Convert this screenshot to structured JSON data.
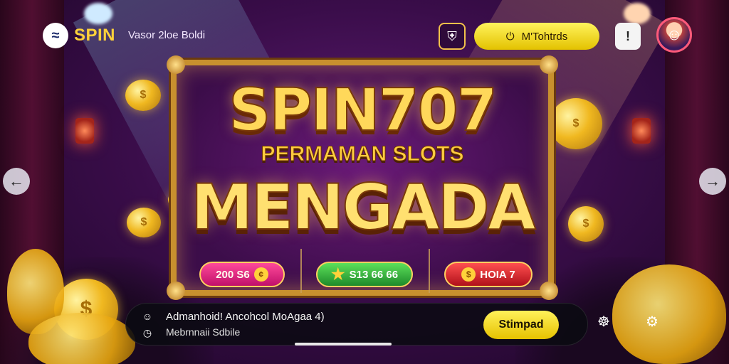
{
  "header": {
    "logo_mark": "≈",
    "logo_text": "SPIN",
    "tagline": "Vasor 2loe Boldi",
    "shield_icon": "shield-check-icon",
    "shield_glyph": "⛨",
    "cta_icon": "power-icon",
    "cta_glyph": "⏻",
    "cta_label": "M'Tohtrds",
    "alert_icon": "alert-icon",
    "alert_glyph": "!",
    "avatar_glyph": "☺"
  },
  "banner": {
    "title": "SPIN707",
    "subtitle": "PERMAMAN SLOTS",
    "headline": "MENGADA",
    "badges": [
      {
        "label": "200 S6",
        "icon_glyph": "¢"
      },
      {
        "label": "S13 66 66",
        "icon_glyph": "★"
      },
      {
        "label": "HOIA 7",
        "icon_glyph": "$"
      }
    ]
  },
  "nav": {
    "prev_glyph": "←",
    "next_glyph": "→"
  },
  "bottom": {
    "icon_top": "☺",
    "icon_bottom": "◷",
    "line1": "Admanhoid! Ancohcol MoAgaa 4)",
    "line2": "Mebrnnaii Sdbile",
    "button_label": "Stimpad",
    "bug_glyph": "☸",
    "gear_glyph": "⚙"
  },
  "colors": {
    "accent_yellow": "#ffd23a",
    "frame_gold": "#c8902e",
    "bg_purple": "#3a0d4a"
  }
}
